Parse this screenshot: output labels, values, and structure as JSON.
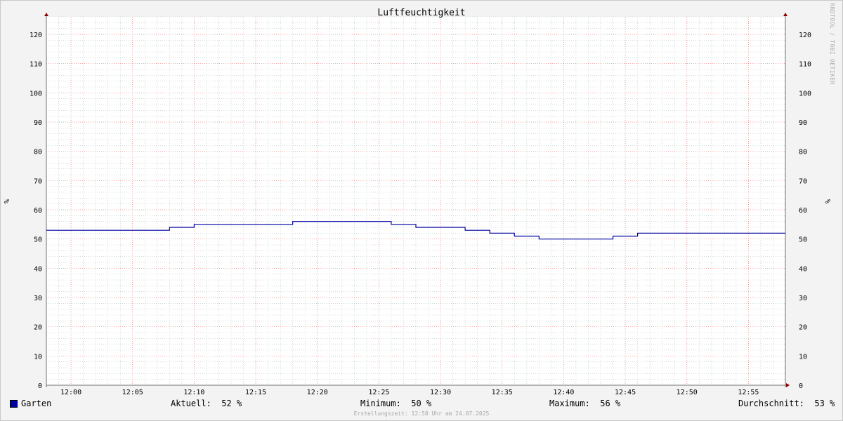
{
  "chart_data": {
    "type": "line",
    "title": "Luftfeuchtigkeit",
    "ylabel": "%",
    "ylim": [
      0,
      126
    ],
    "yticks": [
      0,
      10,
      20,
      30,
      40,
      50,
      60,
      70,
      80,
      90,
      100,
      110,
      120
    ],
    "xlim": [
      "11:58",
      "12:58"
    ],
    "xticks": [
      "12:00",
      "12:05",
      "12:10",
      "12:15",
      "12:20",
      "12:25",
      "12:30",
      "12:35",
      "12:40",
      "12:45",
      "12:50",
      "12:55"
    ],
    "grid": true,
    "series": [
      {
        "name": "Garten",
        "color": "#0000a0",
        "step": true,
        "x": [
          "11:58",
          "12:08",
          "12:10",
          "12:18",
          "12:26",
          "12:28",
          "12:32",
          "12:34",
          "12:36",
          "12:38",
          "12:44",
          "12:46",
          "12:58"
        ],
        "values": [
          53,
          54,
          55,
          56,
          55,
          54,
          53,
          52,
          51,
          50,
          51,
          52,
          52
        ]
      }
    ]
  },
  "watermark": "RRDTOOL / TOBI OETIKER",
  "legend": {
    "series_name": "Garten",
    "current": "Aktuell:  52 %",
    "minimum": "Minimum:  50 %",
    "maximum": "Maximum:  56 %",
    "average": "Durchschnitt:  53 %"
  },
  "footer": "Erstellungszeit: 12:58 Uhr am 24.07.2025",
  "colors": {
    "background": "#f3f3f3",
    "plot_area": "#ffffff",
    "major_grid": "#e08080",
    "minor_grid": "#b8c8c0",
    "axis": "#707070",
    "arrow": "#8b0000",
    "series": "#0000a0"
  }
}
